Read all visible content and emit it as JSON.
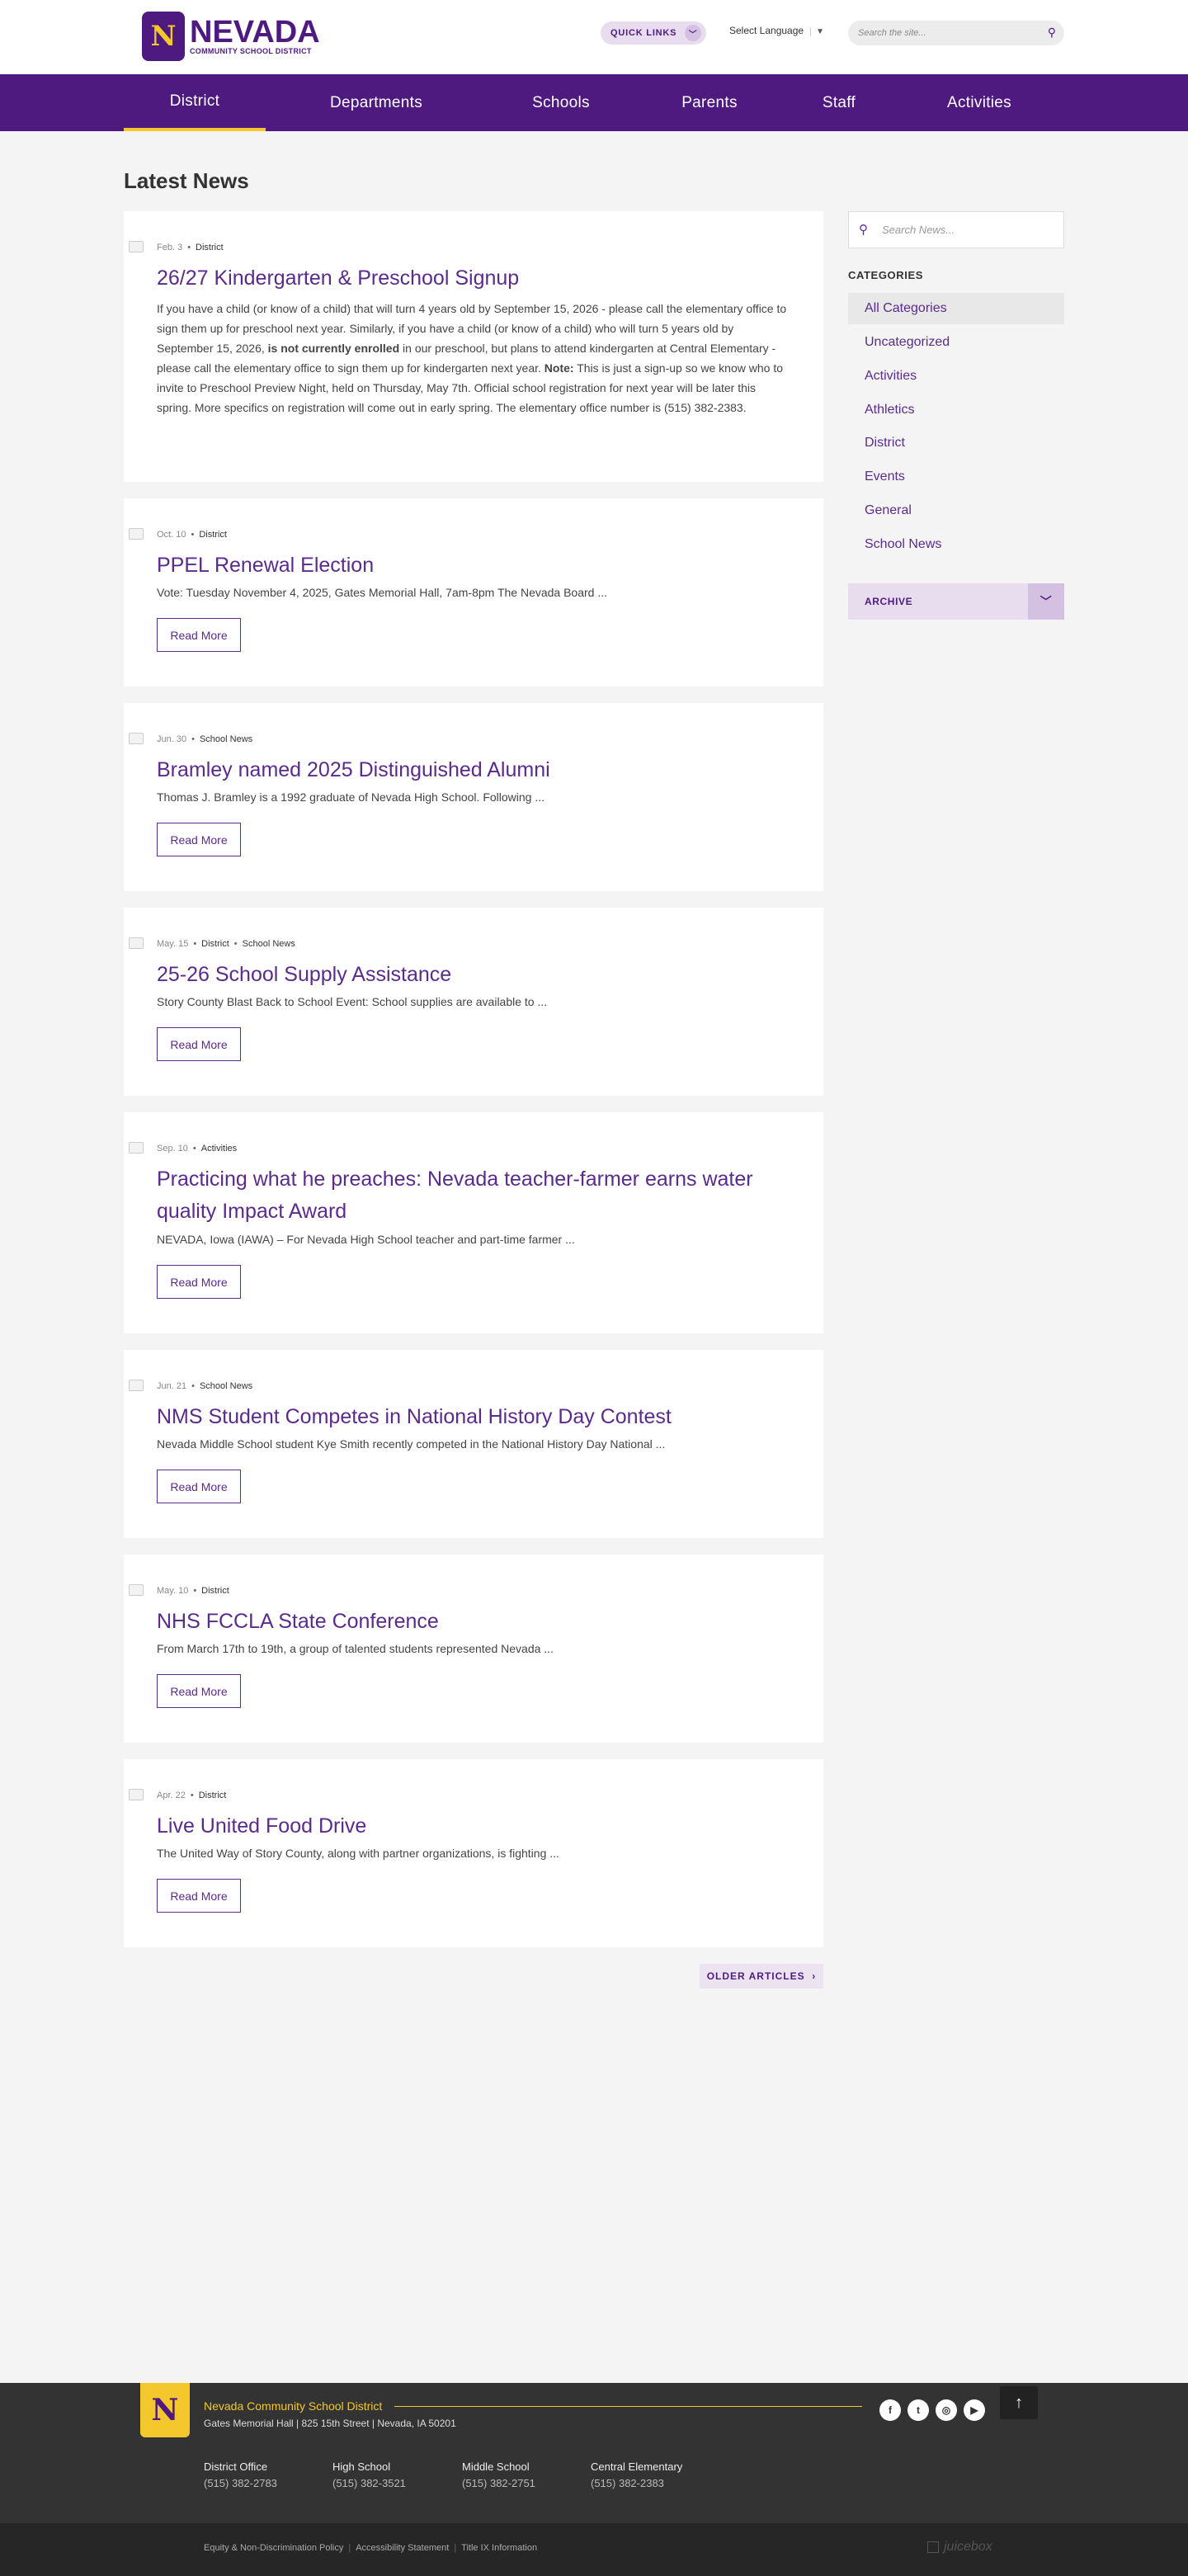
{
  "header": {
    "logo_letter": "N",
    "logo_title": "NEVADA",
    "logo_sub": "COMMUNITY SCHOOL DISTRICT",
    "quick_links": "QUICK LINKS",
    "language": "Select Language",
    "search_placeholder": "Search the site..."
  },
  "nav": [
    "District",
    "Departments",
    "Schools",
    "Parents",
    "Staff",
    "Activities"
  ],
  "page_title": "Latest News",
  "articles": [
    {
      "date": "Feb. 3",
      "cats": [
        "District"
      ],
      "title": "26/27 Kindergarten & Preschool Signup",
      "body_html": "If you have a child (or know of a child) that will turn 4 years old by September 15, 2026 - please call the elementary office to sign them up for preschool next year. Similarly, if you have a child (or know of a child) who will turn 5 years old by September 15, 2026, <b>is not currently enrolled</b> in our preschool, but plans to attend kindergarten at Central Elementary - please call the elementary office to sign them up for kindergarten next year. <b>Note:</b> This is just a sign-up so we know who to invite to Preschool Preview Night, held on Thursday, May 7th.  Official school registration for next year will be later this spring.  More specifics on registration will come out in early spring. The elementary office number is (515) 382-2383."
    },
    {
      "date": "Oct. 10",
      "cats": [
        "District"
      ],
      "title": "PPEL Renewal Election",
      "excerpt": "Vote: Tuesday November 4, 2025, Gates Memorial Hall, 7am-8pm The Nevada Board ...",
      "more": "Read More"
    },
    {
      "date": "Jun. 30",
      "cats": [
        "School News"
      ],
      "title": "Bramley named 2025 Distinguished Alumni",
      "excerpt": "Thomas J. Bramley is a 1992 graduate of Nevada High School. Following ...",
      "more": "Read More"
    },
    {
      "date": "May. 15",
      "cats": [
        "District",
        "School News"
      ],
      "title": "25-26 School Supply Assistance",
      "excerpt": "Story County Blast Back to School Event: School supplies are available to ...",
      "more": "Read More"
    },
    {
      "date": "Sep. 10",
      "cats": [
        "Activities"
      ],
      "title": "Practicing what he preaches: Nevada teacher-farmer earns water quality Impact Award",
      "excerpt": "NEVADA, Iowa (IAWA) – For Nevada High School teacher and part-time farmer ...",
      "more": "Read More"
    },
    {
      "date": "Jun. 21",
      "cats": [
        "School News"
      ],
      "title": "NMS Student Competes in National History Day Contest",
      "excerpt": "Nevada Middle School student Kye Smith recently competed in the National History Day National ...",
      "more": "Read More"
    },
    {
      "date": "May. 10",
      "cats": [
        "District"
      ],
      "title": "NHS FCCLA State Conference",
      "excerpt": "From March 17th to 19th, a group of talented students represented Nevada ...",
      "more": "Read More"
    },
    {
      "date": "Apr. 22",
      "cats": [
        "District"
      ],
      "title": "Live United Food Drive",
      "excerpt": "The United Way of Story County, along with partner organizations, is fighting ...",
      "more": "Read More"
    }
  ],
  "older": "OLDER ARTICLES",
  "sidebar": {
    "search_placeholder": "Search News...",
    "categories_title": "CATEGORIES",
    "categories": [
      "All Categories",
      "Uncategorized",
      "Activities",
      "Athletics",
      "District",
      "Events",
      "General",
      "School News"
    ],
    "archive": "ARCHIVE"
  },
  "footer": {
    "logo_letter": "N",
    "name": "Nevada Community School District",
    "address": "Gates Memorial Hall | 825 15th Street | Nevada, IA 50201",
    "social": [
      "f",
      "t",
      "◎",
      "▶"
    ],
    "contacts": [
      {
        "label": "District Office",
        "phone": "(515) 382-2783"
      },
      {
        "label": "High School",
        "phone": "(515) 382-3521"
      },
      {
        "label": "Middle School",
        "phone": "(515) 382-2751"
      },
      {
        "label": "Central Elementary",
        "phone": "(515) 382-2383"
      }
    ],
    "links": [
      "Equity & Non-Discrimination Policy",
      "Accessibility Statement",
      "Title IX Information"
    ],
    "credit": "juicebox"
  }
}
